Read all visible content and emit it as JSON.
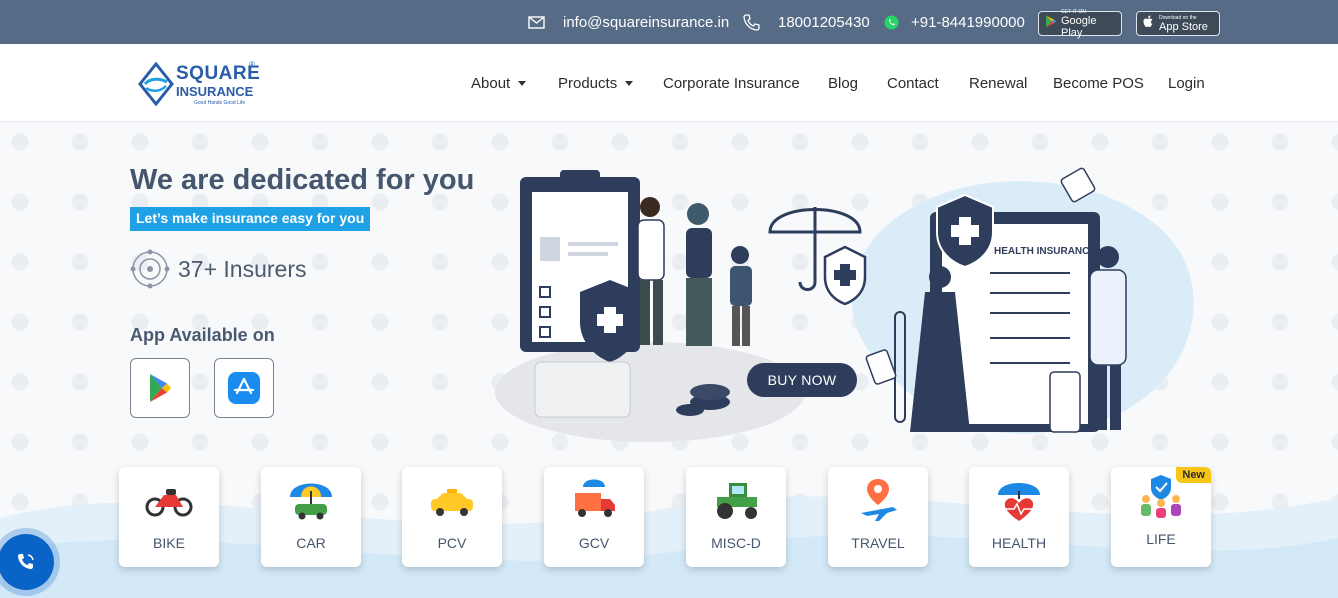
{
  "topbar": {
    "email": "info@squareinsurance.in",
    "phone": "18001205430",
    "whatsapp": "+91-8441990000",
    "google_play": {
      "small": "GET IT ON",
      "big": "Google Play"
    },
    "app_store": {
      "small": "Download on the",
      "big": "App Store"
    },
    "icons": [
      "mail-icon",
      "phone-icon",
      "whatsapp-icon",
      "google-play-icon",
      "apple-icon"
    ]
  },
  "logo": {
    "line1": "SQUARE",
    "line2": "INSURANCE",
    "tagline": "Good Hands Good Life",
    "reg": "®"
  },
  "nav": {
    "items": [
      {
        "label": "About"
      },
      {
        "label": "Products"
      },
      {
        "label": "Corporate Insurance"
      },
      {
        "label": "Blog"
      },
      {
        "label": "Contact"
      },
      {
        "label": "Renewal"
      },
      {
        "label": "Become POS"
      },
      {
        "label": "Login"
      }
    ]
  },
  "hero": {
    "headline": "We are dedicated for you",
    "tagline": "Let’s make insurance easy for you",
    "insurers": "37+ Insurers",
    "app_available": "App Available on",
    "illustration_board_title": "HEALTH INSURANCE",
    "buy_now": "BUY NOW"
  },
  "products": [
    {
      "label": "BIKE"
    },
    {
      "label": "CAR"
    },
    {
      "label": "PCV"
    },
    {
      "label": "GCV"
    },
    {
      "label": "MISC-D"
    },
    {
      "label": "TRAVEL"
    },
    {
      "label": "HEALTH"
    },
    {
      "label": "LIFE",
      "badge": "New"
    }
  ],
  "colors": {
    "topbar": "#566b85",
    "accent": "#1ea1e5",
    "heading": "#45566e",
    "buy_now": "#2e3d5c",
    "badge": "#f5c518"
  }
}
